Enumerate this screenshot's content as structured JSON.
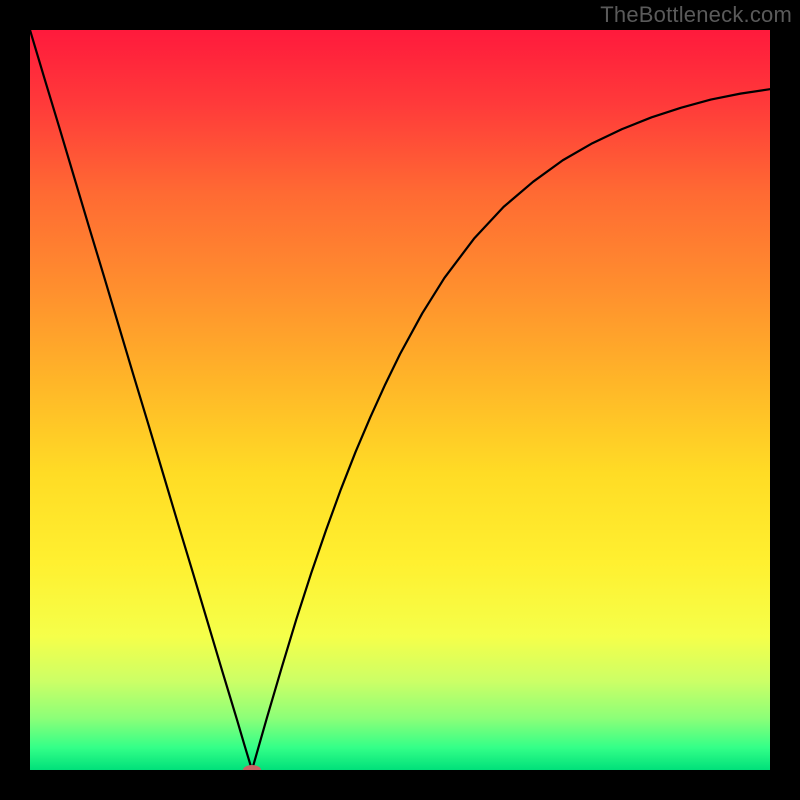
{
  "attribution": "TheBottleneck.com",
  "chart_data": {
    "type": "line",
    "title": "",
    "xlabel": "",
    "ylabel": "",
    "xlim": [
      0,
      100
    ],
    "ylim": [
      0,
      100
    ],
    "grid": false,
    "legend": false,
    "marker": {
      "x": 30,
      "y": 0,
      "color": "#c86464"
    },
    "x": [
      0,
      2,
      4,
      6,
      8,
      10,
      12,
      14,
      16,
      18,
      20,
      22,
      24,
      26,
      27,
      28,
      29,
      30,
      31,
      32,
      33,
      34,
      36,
      38,
      40,
      42,
      44,
      46,
      48,
      50,
      53,
      56,
      60,
      64,
      68,
      72,
      76,
      80,
      84,
      88,
      92,
      96,
      100
    ],
    "values": [
      100,
      93.3,
      86.7,
      80.0,
      73.3,
      66.7,
      60.0,
      53.3,
      46.7,
      40.0,
      33.3,
      26.7,
      20.0,
      13.3,
      10.0,
      6.7,
      3.3,
      0.0,
      3.5,
      7.0,
      10.4,
      13.8,
      20.4,
      26.6,
      32.4,
      37.9,
      43.0,
      47.7,
      52.1,
      56.2,
      61.7,
      66.5,
      71.8,
      76.1,
      79.5,
      82.4,
      84.7,
      86.6,
      88.2,
      89.5,
      90.6,
      91.4,
      92.0
    ],
    "background_gradient": {
      "stops": [
        {
          "offset": 0.0,
          "color": "#ff1a3c"
        },
        {
          "offset": 0.1,
          "color": "#ff3a3a"
        },
        {
          "offset": 0.22,
          "color": "#ff6a33"
        },
        {
          "offset": 0.35,
          "color": "#ff8f2e"
        },
        {
          "offset": 0.48,
          "color": "#ffb728"
        },
        {
          "offset": 0.6,
          "color": "#ffdc25"
        },
        {
          "offset": 0.72,
          "color": "#fff030"
        },
        {
          "offset": 0.82,
          "color": "#f5ff4a"
        },
        {
          "offset": 0.88,
          "color": "#ccff66"
        },
        {
          "offset": 0.93,
          "color": "#8cff78"
        },
        {
          "offset": 0.97,
          "color": "#33ff88"
        },
        {
          "offset": 1.0,
          "color": "#00e07a"
        }
      ]
    }
  }
}
